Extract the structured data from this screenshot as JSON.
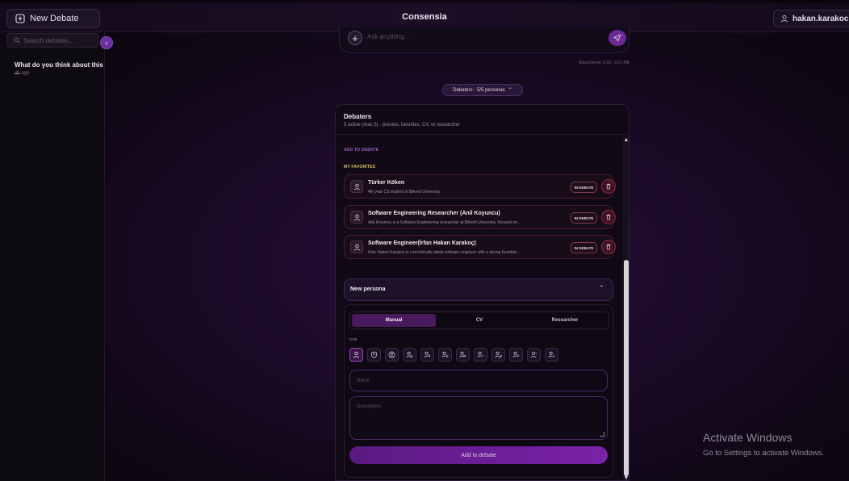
{
  "header": {
    "new_debate_label": "New Debate",
    "app_title": "Consensia",
    "user_label": "hakan.karakoc@u..."
  },
  "sidebar": {
    "search_placeholder": "Search debates...",
    "conversations": [
      {
        "title": "What do you think about this ...",
        "time": "4h ago"
      }
    ]
  },
  "composer": {
    "placeholder": "Ask anything...",
    "attachments_info": "Attachments: 0.00 / 12.0 MB"
  },
  "debaters_pill": {
    "label": "Debaters · 5/5 personas"
  },
  "panel": {
    "title": "Debaters",
    "subtitle": "5 active (max 5) · presets, favorites, CV, or researcher",
    "add_to_debate_label": "ADD TO DEBATE",
    "my_favorites_label": "MY FAVORITES",
    "favorites": [
      {
        "name": "Türker Köken",
        "description": "4th year CS student in Bilkent University.",
        "status": "IN DEBATE"
      },
      {
        "name": "Software Engineering Researcher (Anil Koyuncu)",
        "description": "Anil Koyuncu is a Software Engineering researcher at Bilkent University, focused on...",
        "status": "IN DEBATE"
      },
      {
        "name": "Software Engineer(İrfan Hakan Karakoç)",
        "description": "İrfan Hakan Karakoç is a technically adept software engineer with a strong foundati...",
        "status": "IN DEBATE"
      }
    ],
    "new_persona": {
      "title": "New persona",
      "tabs": [
        "Manual",
        "CV",
        "Researcher"
      ],
      "active_tab": "Manual",
      "icon_label": "Icon",
      "name_placeholder": "Name",
      "description_placeholder": "Description",
      "add_button": "Add to debate"
    }
  },
  "watermark": {
    "title": "Activate Windows",
    "subtitle": "Go to Settings to activate Windows."
  },
  "colors": {
    "accent": "#7a22a8",
    "favorite_border": "#4a1e30",
    "favorites_label": "#d8c060"
  }
}
